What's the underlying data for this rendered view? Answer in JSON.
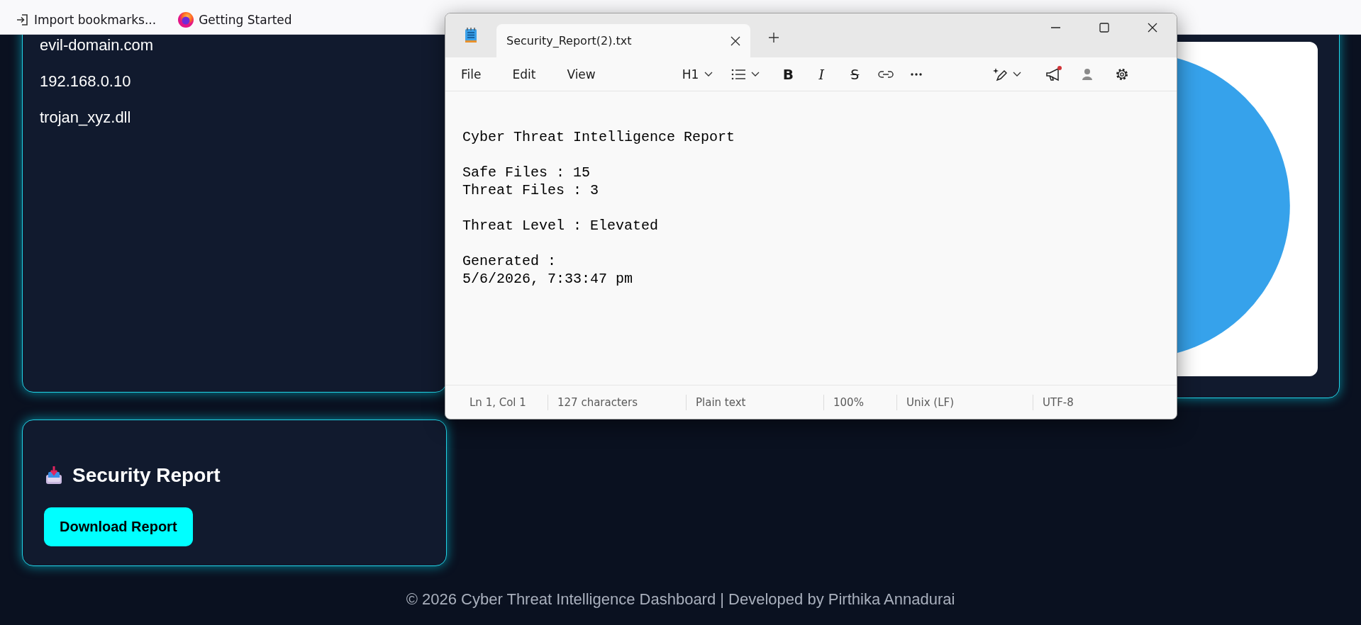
{
  "bookmarks": [
    {
      "kind": "import",
      "label": "Import bookmarks..."
    },
    {
      "kind": "browser",
      "label": "Getting Started"
    }
  ],
  "indicators_card": {
    "items": [
      "evil-domain.com",
      "192.168.0.10",
      "trojan_xyz.dll"
    ]
  },
  "report_card": {
    "title": "Security Report",
    "button": "Download Report"
  },
  "footer": "© 2026 Cyber Threat Intelligence Dashboard | Developed by Pirthika Annadurai",
  "notepad": {
    "tabs": [
      {
        "title": "Security_Report(2).txt",
        "selected": true
      }
    ],
    "menus": [
      "File",
      "Edit",
      "View"
    ],
    "heading": "H1",
    "format_buttons": [
      {
        "kind": "bold",
        "label": "B"
      },
      {
        "kind": "italic",
        "label": "I"
      },
      {
        "kind": "strike",
        "label": "S"
      }
    ],
    "announcements_unread": true,
    "document": [
      [
        "Cyber Threat Intelligence Report"
      ],
      [
        "Safe Files : 15",
        "Threat Files : 3"
      ],
      [
        "Threat Level : Elevated"
      ],
      [
        "Generated :",
        "5/6/2026, 7:33:47 pm"
      ]
    ],
    "status_bar": [
      "Ln 1, Col 1",
      "127 characters",
      "Plain text",
      "100%",
      "Unix (LF)",
      "UTF-8"
    ]
  }
}
